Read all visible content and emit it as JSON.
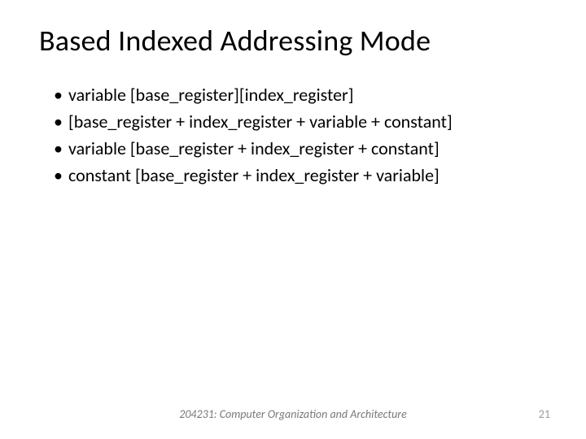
{
  "slide": {
    "title": "Based Indexed Addressing Mode",
    "bullets": [
      "variable [base_register][index_register]",
      "[base_register + index_register + variable + constant]",
      "variable [base_register + index_register + constant]",
      "constant [base_register + index_register + variable]"
    ],
    "footer": "204231: Computer Organization and Architecture",
    "page_number": "21"
  }
}
